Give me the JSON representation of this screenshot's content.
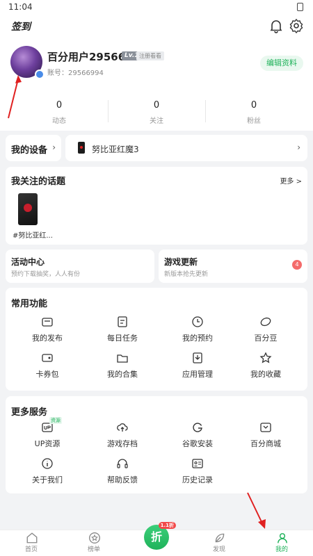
{
  "status": {
    "time": "11:04"
  },
  "topbar": {
    "signin_label": "签到"
  },
  "profile": {
    "username": "百分用户29566994",
    "level": "Lv.1",
    "unregistered": "注册看看",
    "account": "账号：29566994",
    "edit_label": "编辑资料"
  },
  "stats": [
    {
      "value": "0",
      "label": "动态"
    },
    {
      "value": "0",
      "label": "关注"
    },
    {
      "value": "0",
      "label": "粉丝"
    }
  ],
  "device": {
    "title": "我的设备",
    "phone": "努比亚红魔3"
  },
  "topics": {
    "title": "我关注的话题",
    "more": "更多 >",
    "items": [
      {
        "label": "#努比亚红..."
      }
    ]
  },
  "activity": {
    "title": "活动中心",
    "subtitle": "预约下载抽奖，人人有份"
  },
  "game_update": {
    "title": "游戏更新",
    "subtitle": "新版本抢先更新",
    "count": "4"
  },
  "common": {
    "title": "常用功能",
    "items": [
      {
        "label": "我的发布",
        "icon": "edit-icon"
      },
      {
        "label": "每日任务",
        "icon": "task-icon"
      },
      {
        "label": "我的预约",
        "icon": "clock-icon"
      },
      {
        "label": "百分豆",
        "icon": "bean-icon"
      },
      {
        "label": "卡券包",
        "icon": "coupon-icon"
      },
      {
        "label": "我的合集",
        "icon": "collection-icon"
      },
      {
        "label": "应用管理",
        "icon": "app-manage-icon"
      },
      {
        "label": "我的收藏",
        "icon": "star-icon"
      }
    ]
  },
  "more_services": {
    "title": "更多服务",
    "items": [
      {
        "label": "UP资源",
        "icon": "up-icon",
        "tag": "资源"
      },
      {
        "label": "游戏存档",
        "icon": "cloud-upload-icon"
      },
      {
        "label": "谷歌安装",
        "icon": "google-icon"
      },
      {
        "label": "百分商城",
        "icon": "shop-icon"
      },
      {
        "label": "关于我们",
        "icon": "info-icon"
      },
      {
        "label": "帮助反馈",
        "icon": "headset-icon"
      },
      {
        "label": "历史记录",
        "icon": "history-icon"
      }
    ]
  },
  "nav": {
    "items": [
      {
        "label": "首页",
        "icon": "home-icon"
      },
      {
        "label": "榜单",
        "icon": "ranking-icon"
      },
      {
        "label": "折",
        "icon": "discount-icon",
        "tag": "1.1折"
      },
      {
        "label": "发现",
        "icon": "discover-icon"
      },
      {
        "label": "我的",
        "icon": "profile-icon"
      }
    ]
  },
  "colors": {
    "accent": "#1fb25a",
    "badge_red": "#f46b6b",
    "annotation_red": "#e02020"
  }
}
